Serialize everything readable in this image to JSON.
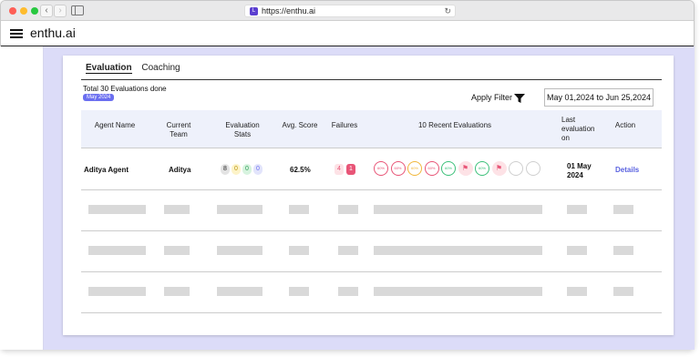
{
  "browser": {
    "url": "https://enthu.ai",
    "favicon_letter": "L"
  },
  "app": {
    "brand": "enthu.ai"
  },
  "tabs": [
    {
      "label": "Evaluation",
      "active": true
    },
    {
      "label": "Coaching",
      "active": false
    }
  ],
  "summary": {
    "total_text": "Total 30 Evaluations done",
    "period_badge": "May 2024"
  },
  "filter": {
    "apply_label": "Apply Filter",
    "date_range": "May 01,2024 to Jun 25,2024"
  },
  "table": {
    "headers": [
      "Agent Name",
      "Current Team",
      "Evaluation Stats",
      "Avg. Score",
      "Failures",
      "10 Recent Evaluations",
      "Last evaluation on",
      "Action"
    ],
    "rows": [
      {
        "agent_name": "Aditya Agent",
        "team": "Aditya",
        "stats": [
          "8",
          "0",
          "0",
          "0"
        ],
        "avg_score": "62.5%",
        "failures": [
          "4",
          "1"
        ],
        "last_eval": "01 May 2024",
        "action": "Details"
      }
    ],
    "recent_evaluations": [
      {
        "kind": "score",
        "label": "60%",
        "color": "#e85577"
      },
      {
        "kind": "score",
        "label": "60%",
        "color": "#e85577"
      },
      {
        "kind": "score",
        "label": "60%",
        "color": "#f1b73b"
      },
      {
        "kind": "score",
        "label": "60%",
        "color": "#e85577"
      },
      {
        "kind": "score",
        "label": "60%",
        "color": "#3cc07a"
      },
      {
        "kind": "flag",
        "label": "⚑",
        "color": "#e85577"
      },
      {
        "kind": "score",
        "label": "60%",
        "color": "#3cc07a"
      },
      {
        "kind": "flag",
        "label": "⚑",
        "color": "#e85577"
      },
      {
        "kind": "empty",
        "label": "",
        "color": "#cfcfcf"
      },
      {
        "kind": "empty",
        "label": "",
        "color": "#cfcfcf"
      }
    ]
  },
  "colors": {
    "accent": "#6b6ff0",
    "content_bg": "#dcdcf8",
    "header_bg": "#eef1fb",
    "link": "#5a62e0"
  }
}
